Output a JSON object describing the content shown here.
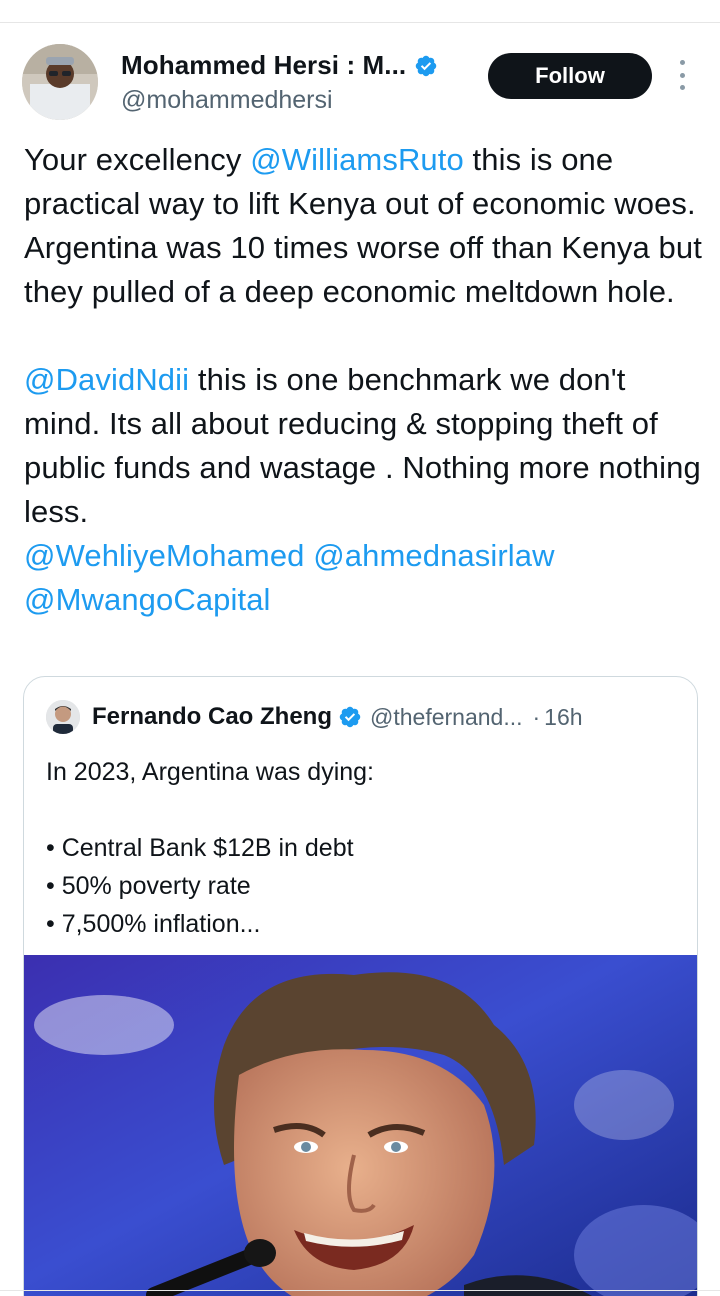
{
  "author": {
    "display_name": "Mohammed Hersi : M...",
    "handle": "@mohammedhersi"
  },
  "follow_label": "Follow",
  "tweet": {
    "p1_a": "Your excellency ",
    "p1_mention": "@WilliamsRuto",
    "p1_b": " this is one practical way to lift Kenya out of economic woes. Argentina was 10 times worse off than Kenya but they pulled of a deep economic meltdown hole.",
    "p2_lead": " ",
    "p2_mention": "@DavidNdii",
    "p2_b": " this is one benchmark we don't mind. Its all about reducing & stopping theft of public funds and wastage . Nothing more nothing less.",
    "m3": "@WehliyeMohamed",
    "m4": "@ahmednasirlaw",
    "m5": "@MwangoCapital"
  },
  "quote": {
    "display_name": "Fernando Cao Zheng",
    "handle": "@thefernand...",
    "separator": "·",
    "time": "16h",
    "line1": "In 2023, Argentina was dying:",
    "bullets": [
      "• Central Bank $12B in debt",
      "• 50% poverty rate",
      "• 7,500% inflation..."
    ]
  },
  "colors": {
    "link": "#1d9bf0",
    "verified": "#1d9bf0",
    "follow_bg": "#0f1419"
  }
}
